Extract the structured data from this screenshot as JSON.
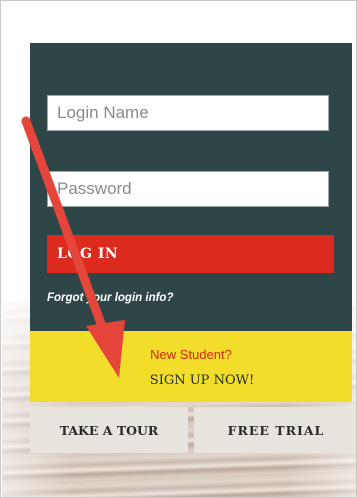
{
  "login": {
    "login_name_placeholder": "Login Name",
    "password_placeholder": "Password",
    "login_button_label": "LOG IN",
    "forgot_link_text": "Forgot your login info?"
  },
  "signup": {
    "prompt": "New Student?",
    "cta": "SIGN UP NOW!"
  },
  "actions": {
    "tour_label": "TAKE A TOUR",
    "trial_label": "FREE TRIAL"
  },
  "colors": {
    "panel": "#2f4649",
    "login_button": "#dc2a1f",
    "signup_background": "#f2de2a",
    "signup_prompt": "#d9261c",
    "arrow": "#e5453a",
    "secondary_buttons": "#e7e4dd"
  },
  "annotation": {
    "icon": "red-arrow-icon"
  }
}
